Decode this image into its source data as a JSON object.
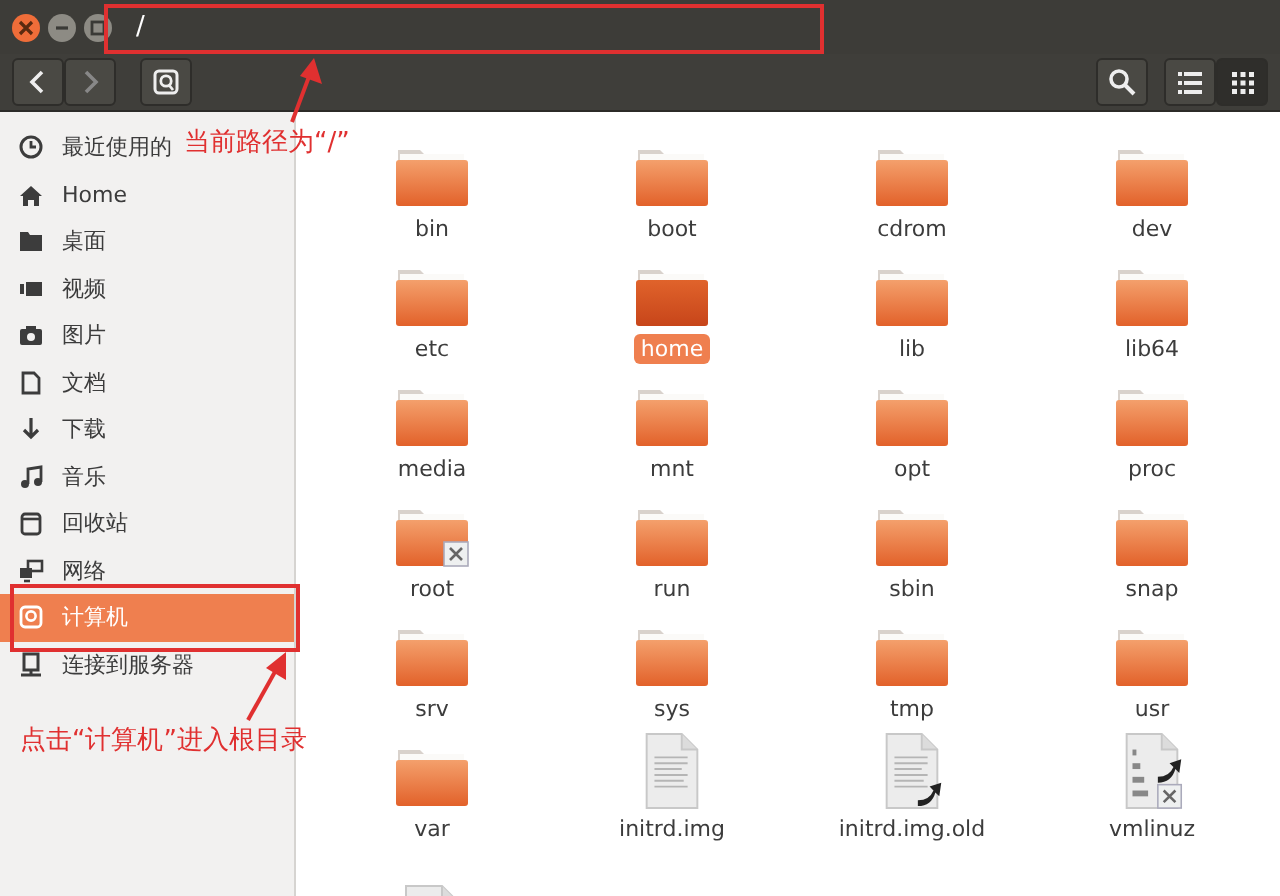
{
  "window": {
    "path": "/"
  },
  "toolbar": {
    "back_disabled": false,
    "forward_disabled": true,
    "view_buttons": [
      {
        "selected": false
      },
      {
        "selected": true
      }
    ]
  },
  "sidebar": {
    "items": [
      {
        "label": "最近使用的",
        "selected": false
      },
      {
        "label": "Home",
        "selected": false
      },
      {
        "label": "桌面",
        "selected": false
      },
      {
        "label": "视频",
        "selected": false
      },
      {
        "label": "图片",
        "selected": false
      },
      {
        "label": "文档",
        "selected": false
      },
      {
        "label": "下载",
        "selected": false
      },
      {
        "label": "音乐",
        "selected": false
      },
      {
        "label": "回收站",
        "selected": false
      },
      {
        "label": "网络",
        "selected": false
      },
      {
        "label": "计算机",
        "selected": true
      },
      {
        "label": "连接到服务器",
        "selected": false
      }
    ]
  },
  "files": [
    {
      "name": "bin",
      "kind": "folder",
      "selected": false,
      "locked": false,
      "link": false
    },
    {
      "name": "boot",
      "kind": "folder",
      "selected": false,
      "locked": false,
      "link": false
    },
    {
      "name": "cdrom",
      "kind": "folder",
      "selected": false,
      "locked": false,
      "link": false
    },
    {
      "name": "dev",
      "kind": "folder",
      "selected": false,
      "locked": false,
      "link": false
    },
    {
      "name": "etc",
      "kind": "folder",
      "selected": false,
      "locked": false,
      "link": false
    },
    {
      "name": "home",
      "kind": "folder",
      "selected": true,
      "locked": false,
      "link": false
    },
    {
      "name": "lib",
      "kind": "folder",
      "selected": false,
      "locked": false,
      "link": false
    },
    {
      "name": "lib64",
      "kind": "folder",
      "selected": false,
      "locked": false,
      "link": false
    },
    {
      "name": "media",
      "kind": "folder",
      "selected": false,
      "locked": false,
      "link": false
    },
    {
      "name": "mnt",
      "kind": "folder",
      "selected": false,
      "locked": false,
      "link": false
    },
    {
      "name": "opt",
      "kind": "folder",
      "selected": false,
      "locked": false,
      "link": false
    },
    {
      "name": "proc",
      "kind": "folder",
      "selected": false,
      "locked": false,
      "link": false
    },
    {
      "name": "root",
      "kind": "folder",
      "selected": false,
      "locked": true,
      "link": false
    },
    {
      "name": "run",
      "kind": "folder",
      "selected": false,
      "locked": false,
      "link": false
    },
    {
      "name": "sbin",
      "kind": "folder",
      "selected": false,
      "locked": false,
      "link": false
    },
    {
      "name": "snap",
      "kind": "folder",
      "selected": false,
      "locked": false,
      "link": false
    },
    {
      "name": "srv",
      "kind": "folder",
      "selected": false,
      "locked": false,
      "link": false
    },
    {
      "name": "sys",
      "kind": "folder",
      "selected": false,
      "locked": false,
      "link": false
    },
    {
      "name": "tmp",
      "kind": "folder",
      "selected": false,
      "locked": false,
      "link": false
    },
    {
      "name": "usr",
      "kind": "folder",
      "selected": false,
      "locked": false,
      "link": false
    },
    {
      "name": "var",
      "kind": "folder",
      "selected": false,
      "locked": false,
      "link": false
    },
    {
      "name": "initrd.img",
      "kind": "text",
      "selected": false,
      "locked": false,
      "link": false
    },
    {
      "name": "initrd.img.old",
      "kind": "text",
      "selected": false,
      "locked": false,
      "link": true
    },
    {
      "name": "vmlinuz",
      "kind": "binary",
      "selected": false,
      "locked": true,
      "link": true
    },
    {
      "kind": "text"
    }
  ],
  "annotations": [
    {
      "text": "当前路径为“/”"
    },
    {
      "text": "点击“计算机”进入根目录"
    }
  ]
}
